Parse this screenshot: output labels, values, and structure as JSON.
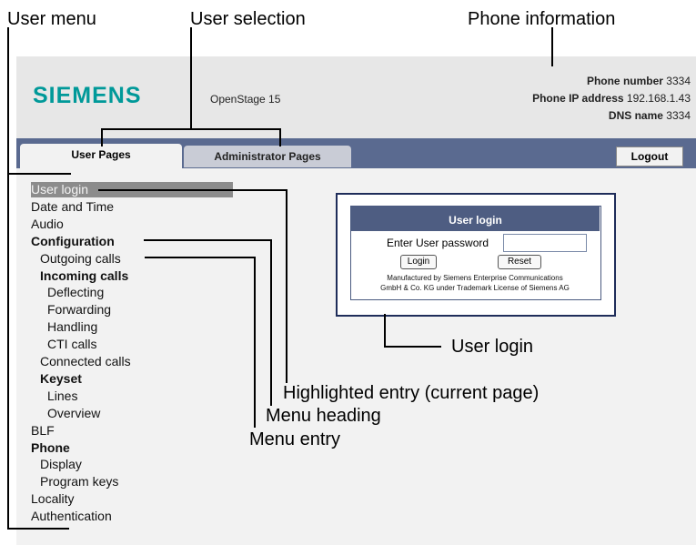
{
  "callouts": {
    "user_menu": "User menu",
    "user_selection": "User selection",
    "phone_information": "Phone information",
    "user_login": "User login",
    "highlighted_entry": "Highlighted entry (current page)",
    "menu_heading": "Menu heading",
    "menu_entry": "Menu entry"
  },
  "header": {
    "logo": "SIEMENS",
    "model": "OpenStage 15",
    "phone_number_label": "Phone number",
    "phone_number_value": "3334",
    "ip_label": "Phone IP address",
    "ip_value": "192.168.1.43",
    "dns_label": "DNS name",
    "dns_value": "3334"
  },
  "tabs": {
    "user_pages": "User Pages",
    "admin_pages": "Administrator Pages",
    "logout": "Logout"
  },
  "menu": [
    {
      "label": "User login",
      "style": "highlight"
    },
    {
      "label": "Date and Time",
      "style": "item"
    },
    {
      "label": "Audio",
      "style": "item"
    },
    {
      "label": "Configuration",
      "style": "heading"
    },
    {
      "label": "Outgoing calls",
      "style": "item"
    },
    {
      "label": "Incoming calls",
      "style": "heading"
    },
    {
      "label": "Deflecting",
      "style": "item"
    },
    {
      "label": "Forwarding",
      "style": "item"
    },
    {
      "label": "Handling",
      "style": "item"
    },
    {
      "label": "CTI calls",
      "style": "item"
    },
    {
      "label": "Connected calls",
      "style": "item"
    },
    {
      "label": "Keyset",
      "style": "heading"
    },
    {
      "label": "Lines",
      "style": "item"
    },
    {
      "label": "Overview",
      "style": "item"
    },
    {
      "label": "BLF",
      "style": "item"
    },
    {
      "label": "Phone",
      "style": "heading"
    },
    {
      "label": "Display",
      "style": "item"
    },
    {
      "label": "Program keys",
      "style": "item"
    },
    {
      "label": "Locality",
      "style": "item"
    },
    {
      "label": "Authentication",
      "style": "item"
    }
  ],
  "login": {
    "title": "User login",
    "password_label": "Enter User password",
    "password_value": "",
    "login_button": "Login",
    "reset_button": "Reset",
    "fineprint_1": "Manufactured by Siemens Enterprise Communications",
    "fineprint_2": "GmbH & Co. KG under Trademark License of Siemens AG"
  },
  "colors": {
    "logo": "#009999",
    "tabbar": "#5a6a90",
    "highlight": "#8c8c8c",
    "login_header": "#4e5d82"
  }
}
